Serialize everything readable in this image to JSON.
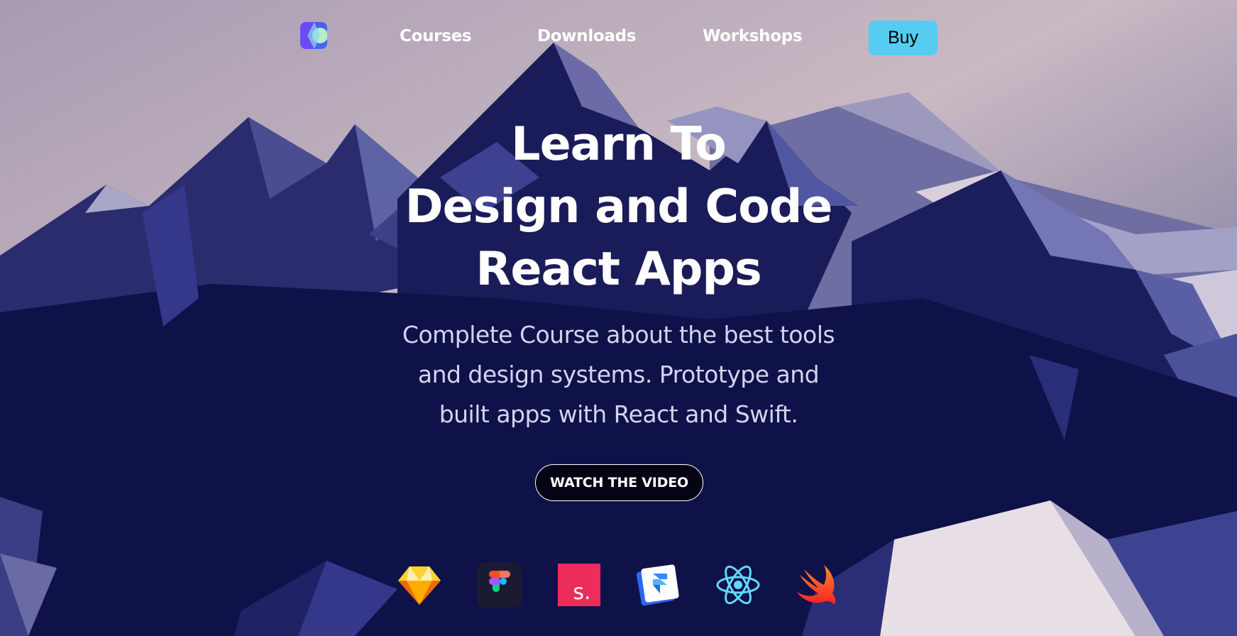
{
  "nav": {
    "logo_icon": "k-logo-icon",
    "links": [
      {
        "label": "Courses"
      },
      {
        "label": "Downloads"
      },
      {
        "label": "Workshops"
      }
    ],
    "buy_label": "Buy"
  },
  "hero": {
    "title_lines": [
      "Learn To",
      "Design and Code",
      "React Apps"
    ],
    "subtitle": "Complete Course about the best tools and design systems. Prototype and built apps with React and Swift.",
    "cta_label": "WATCH THE VIDEO"
  },
  "tools": [
    {
      "icon": "sketch-icon"
    },
    {
      "icon": "figma-icon"
    },
    {
      "icon": "studio-icon",
      "label": "s."
    },
    {
      "icon": "framer-icon"
    },
    {
      "icon": "react-icon"
    },
    {
      "icon": "swift-icon"
    }
  ],
  "colors": {
    "buy_button": "#56ccf2",
    "mountain_dark": "#0e1046",
    "subtitle_text": "#d4d4ec"
  }
}
